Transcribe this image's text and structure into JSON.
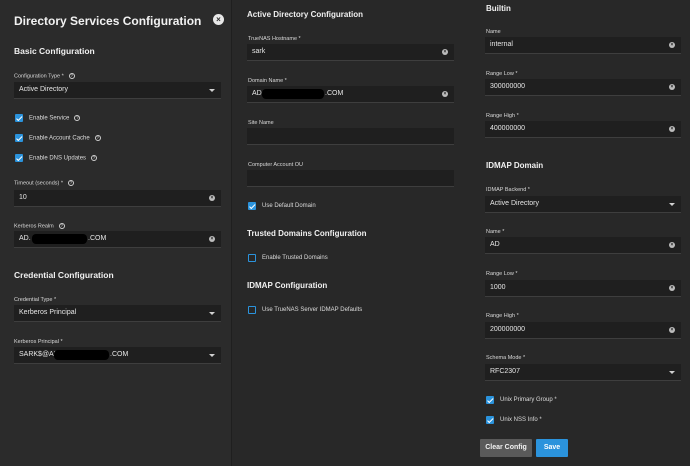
{
  "left": {
    "title": "Directory Services Configuration",
    "basic_heading": "Basic Configuration",
    "config_type_label": "Configuration Type *",
    "config_type_value": "Active Directory",
    "enable_service": "Enable Service",
    "enable_account_cache": "Enable Account Cache",
    "enable_dns_updates": "Enable DNS Updates",
    "timeout_label": "Timeout (seconds) *",
    "timeout_value": "10",
    "kerberos_realm_label": "Kerberos Realm",
    "kerberos_realm_prefix": "AD.",
    "kerberos_realm_suffix": ".COM",
    "credential_heading": "Credential Configuration",
    "credential_type_label": "Credential Type *",
    "credential_type_value": "Kerberos Principal",
    "kerberos_principal_label": "Kerberos Principal *",
    "kerberos_principal_prefix": "SARK$@AD.",
    "kerberos_principal_suffix": ".COM"
  },
  "mid": {
    "ad_heading": "Active Directory Configuration",
    "hostname_label": "TrueNAS Hostname *",
    "hostname_value": "sark",
    "domain_label": "Domain Name *",
    "domain_prefix": "AD.",
    "domain_suffix": ".COM",
    "site_label": "Site Name",
    "site_value": "",
    "computer_ou_label": "Computer Account OU",
    "computer_ou_value": "",
    "use_default_domain": "Use Default Domain",
    "trusted_heading": "Trusted Domains Configuration",
    "enable_trusted": "Enable Trusted Domains",
    "idmap_heading": "IDMAP Configuration",
    "use_truenas_idmap": "Use TrueNAS Server IDMAP Defaults"
  },
  "right": {
    "builtin_heading": "Builtin",
    "name_label": "Name",
    "name_value": "internal",
    "range_low_label": "Range Low *",
    "range_low_value": "300000000",
    "range_high_label": "Range High *",
    "range_high_value": "400000000",
    "idmap_domain_heading": "IDMAP Domain",
    "idmap_backend_label": "IDMAP Backend *",
    "idmap_backend_value": "Active Directory",
    "domain_name_label": "Name *",
    "domain_name_value": "AD",
    "domain_range_low_label": "Range Low *",
    "domain_range_low_value": "1000",
    "domain_range_high_label": "Range High *",
    "domain_range_high_value": "200000000",
    "schema_label": "Schema Mode *",
    "schema_value": "RFC2307",
    "unix_primary_group": "Unix Primary Group *",
    "unix_nss_info": "Unix NSS Info *",
    "clear_config": "Clear Config",
    "save": "Save"
  },
  "icons": {
    "close": "×",
    "clear": "×",
    "help": "?"
  },
  "colors": {
    "accent": "#2b93dc",
    "panel": "#2b2b2b",
    "field": "#1f1f1f"
  }
}
